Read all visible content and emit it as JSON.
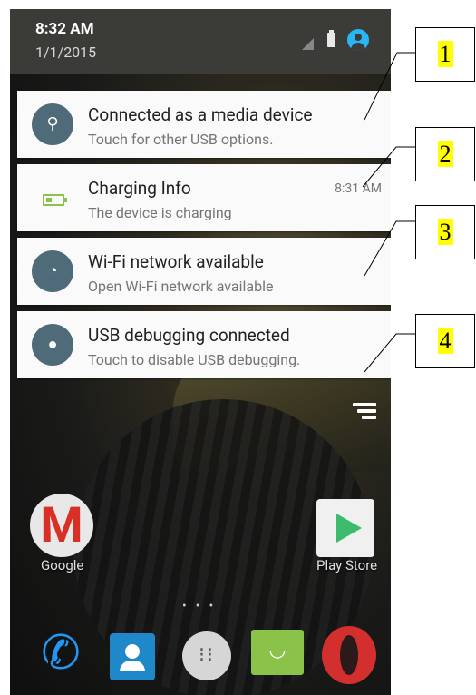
{
  "status_bar": {
    "time": "8:32 AM",
    "date": "1/1/2015"
  },
  "notifications": [
    {
      "icon": "usb-icon",
      "title": "Connected as a media device",
      "subtitle": "Touch for other USB options.",
      "time": ""
    },
    {
      "icon": "battery-icon",
      "title": "Charging Info",
      "subtitle": "The device is charging",
      "time": "8:31 AM"
    },
    {
      "icon": "wifi-icon",
      "title": "Wi-Fi network available",
      "subtitle": "Open Wi-Fi network available",
      "time": ""
    },
    {
      "icon": "android-icon",
      "title": "USB debugging connected",
      "subtitle": "Touch to disable USB debugging.",
      "time": ""
    }
  ],
  "home": {
    "left_app": "Google",
    "right_app": "Play Store"
  },
  "callouts": [
    "1",
    "2",
    "3",
    "4"
  ]
}
